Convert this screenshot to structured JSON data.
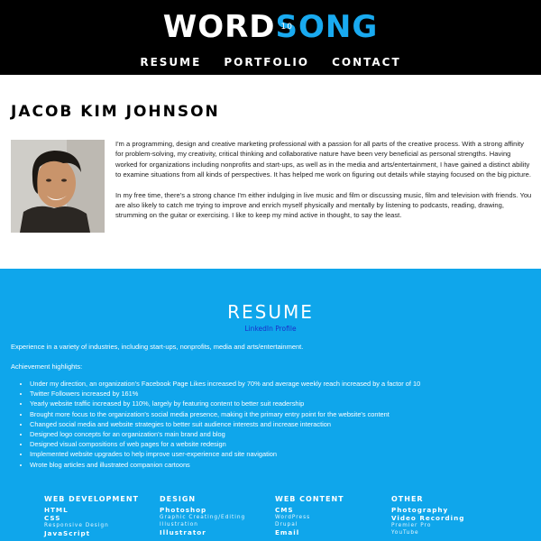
{
  "header": {
    "logo": {
      "word": "WORD",
      "s_letter": "S",
      "s_number": "10",
      "ong": "ONG"
    },
    "nav": [
      "RESUME",
      "PORTFOLIO",
      "CONTACT"
    ]
  },
  "profile": {
    "name": "JACOB KIM JOHNSON",
    "bio": [
      "I'm a programming, design and creative marketing professional with a passion for all parts of the creative process. With a strong affinity for problem-solving, my creativity, critical thinking and collaborative nature have been very beneficial as personal strengths. Having worked for organizations including nonprofits and start-ups, as well as in the media and arts/entertainment, I have gained a distinct ability to examine situations from all kinds of perspectives. It has helped me work on figuring out details while staying focused on the big picture.",
      "In my free time, there's a strong chance I'm either indulging in live music and film or discussing music, film and television with friends. You are also likely to catch me trying to improve and enrich myself physically and mentally by listening to podcasts, reading, drawing, strumming on the guitar or exercising. I like to keep my mind active in thought, to say the least."
    ]
  },
  "resume": {
    "title": "RESUME",
    "linkedin": "LinkedIn Profile",
    "intro": "Experience in a variety of industries, including start-ups, nonprofits, media and arts/entertainment.",
    "highlights_heading": "Achievement highlights:",
    "highlights": [
      "Under my direction, an organization's Facebook Page Likes increased by 70% and average weekly reach increased by a factor of 10",
      "Twitter Followers increased by 161%",
      "Yearly website traffic increased by 110%, largely by featuring content to better suit readership",
      "Brought more focus to the organization's social media presence, making it the primary entry point for the website's content",
      "Changed social media and website strategies to better suit audience interests and increase interaction",
      "Designed logo concepts for an organization's main brand and blog",
      "Designed visual compositions of web pages for a website redesign",
      "Implemented website upgrades to help improve user-experience and site navigation",
      "Wrote blog articles and illustrated companion cartoons"
    ],
    "skills": [
      {
        "heading": "WEB DEVELOPMENT",
        "items": [
          {
            "name": "HTML",
            "sub": ""
          },
          {
            "name": "CSS",
            "sub": "Responsive Design"
          },
          {
            "name": "JavaScript",
            "sub": ""
          }
        ]
      },
      {
        "heading": "DESIGN",
        "items": [
          {
            "name": "Photoshop",
            "sub": "Graphic Creating/Editing"
          },
          {
            "name": "",
            "sub": "Illustration"
          },
          {
            "name": "Illustrator",
            "sub": ""
          }
        ]
      },
      {
        "heading": "WEB CONTENT",
        "items": [
          {
            "name": "CMS",
            "sub": "WordPress"
          },
          {
            "name": "",
            "sub": "Drupal"
          },
          {
            "name": "Email",
            "sub": ""
          }
        ]
      },
      {
        "heading": "OTHER",
        "items": [
          {
            "name": "Photography",
            "sub": ""
          },
          {
            "name": "Video Recording",
            "sub": "Premier Pro"
          },
          {
            "name": "",
            "sub": "YouTube"
          }
        ]
      }
    ]
  }
}
